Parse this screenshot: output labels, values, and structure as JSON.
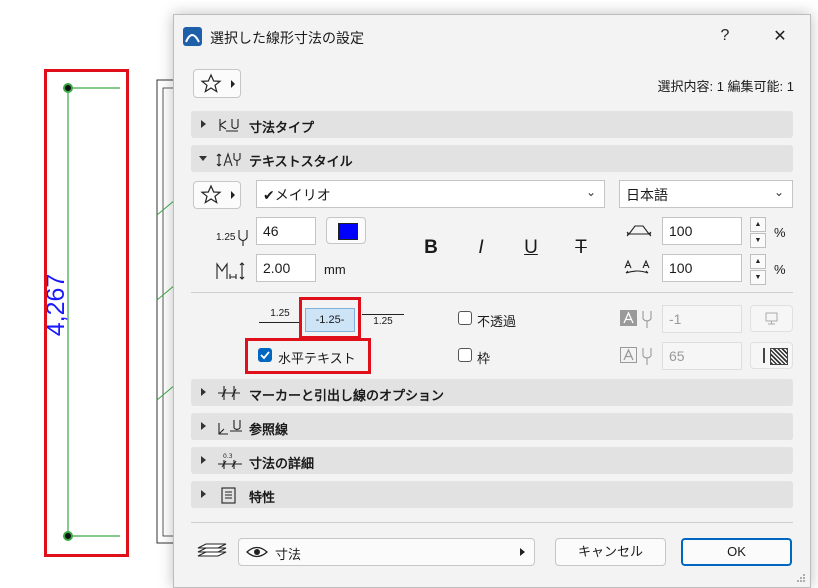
{
  "drawing": {
    "dimension_value": "4,267"
  },
  "dialog": {
    "title": "選択した線形寸法の設定",
    "help_label": "?",
    "close_label": "✕",
    "selection_info": "選択内容: 1 編集可能: 1",
    "sections": {
      "dimension_type": "寸法タイプ",
      "text_style": "テキストスタイル",
      "marker_options": "マーカーと引出し線のオプション",
      "reference_line": "参照線",
      "dimension_detail": "寸法の詳細",
      "properties": "特性"
    },
    "text_style": {
      "font": "✔メイリオ",
      "language": "日本語",
      "size_value": "46",
      "spacing_value": "2.00",
      "spacing_unit": "mm",
      "width_value": "100",
      "slant_value": "100",
      "percent": "%",
      "size_icon_text": "1.25",
      "bold_label": "B",
      "italic_label": "I",
      "underline_label": "U",
      "strike_label": "T",
      "color_hex": "#0000ff"
    },
    "placement": {
      "above_label": "1.25",
      "inline_label": "-1.25-",
      "below_label": "1.25",
      "horizontal_text_label": "水平テキスト",
      "horizontal_text_checked": true,
      "opaque_label": "不透過",
      "opaque_checked": false,
      "frame_label": "枠",
      "frame_checked": false,
      "opaque_pen_value": "-1",
      "frame_pen_value": "65"
    },
    "footer": {
      "layer_label": "寸法",
      "cancel_label": "キャンセル",
      "ok_label": "OK"
    }
  }
}
